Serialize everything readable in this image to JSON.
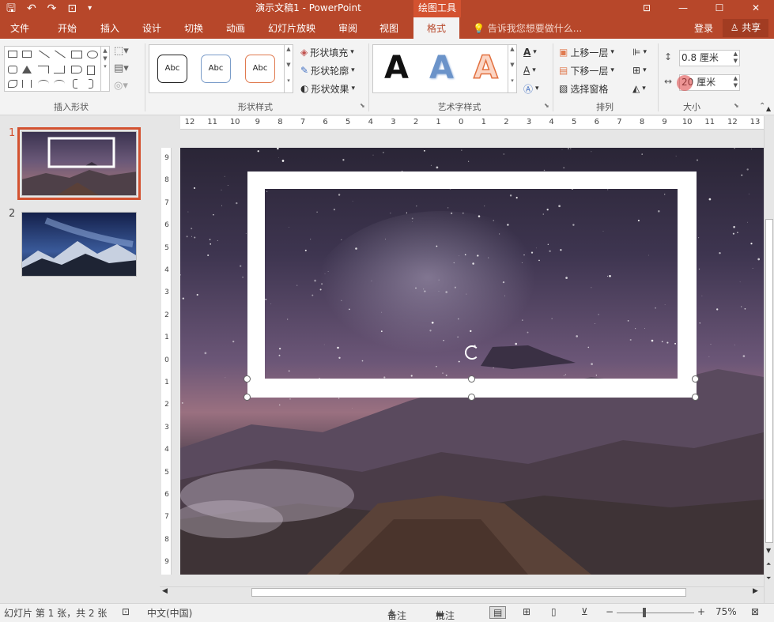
{
  "titlebar": {
    "doc_title": "演示文稿1 - PowerPoint",
    "contextual_tab": "绘图工具",
    "qat": {
      "save": "🖫",
      "undo": "↶",
      "redo": "↷",
      "present": "⊡",
      "more": "▾"
    },
    "window_controls": {
      "ribbon_options": "⊡",
      "minimize": "—",
      "restore": "☐",
      "close": "✕"
    }
  },
  "tabs": [
    "文件",
    "开始",
    "插入",
    "设计",
    "切换",
    "动画",
    "幻灯片放映",
    "审阅",
    "视图",
    "格式"
  ],
  "active_tab": "格式",
  "tellme": "告诉我您想要做什么...",
  "signin": "登录",
  "share": "共享",
  "ribbon": {
    "insert_shapes": {
      "label": "插入形状"
    },
    "shape_styles": {
      "label": "形状样式",
      "gallery": [
        "Abc",
        "Abc",
        "Abc"
      ],
      "fill": "形状填充",
      "outline": "形状轮廓",
      "effects": "形状效果"
    },
    "wordart": {
      "label": "艺术字样式",
      "samples": [
        "A",
        "A",
        "A"
      ]
    },
    "arrange": {
      "label": "排列",
      "bring_forward": "上移一层",
      "send_backward": "下移一层",
      "selection_pane": "选择窗格"
    },
    "size": {
      "label": "大小",
      "height": "0.8 厘米",
      "width": "20 厘米"
    }
  },
  "slides": [
    {
      "number": "1"
    },
    {
      "number": "2"
    }
  ],
  "rulers": {
    "horizontal": [
      "12",
      "11",
      "10",
      "9",
      "8",
      "7",
      "6",
      "5",
      "4",
      "3",
      "2",
      "1",
      "0",
      "1",
      "2",
      "3",
      "4",
      "5",
      "6",
      "7",
      "8",
      "9",
      "10",
      "11",
      "12",
      "13"
    ],
    "vertical": [
      "9",
      "8",
      "7",
      "6",
      "5",
      "4",
      "3",
      "2",
      "1",
      "0",
      "1",
      "2",
      "3",
      "4",
      "5",
      "6",
      "7",
      "8",
      "9"
    ]
  },
  "status": {
    "slide_info": "幻灯片 第 1 张，共 2 张",
    "language": "中文(中国)",
    "notes": "备注",
    "comments": "批注",
    "zoom": "75%"
  },
  "colors": {
    "accent": "#b7472a",
    "accent_light": "#d35230"
  }
}
